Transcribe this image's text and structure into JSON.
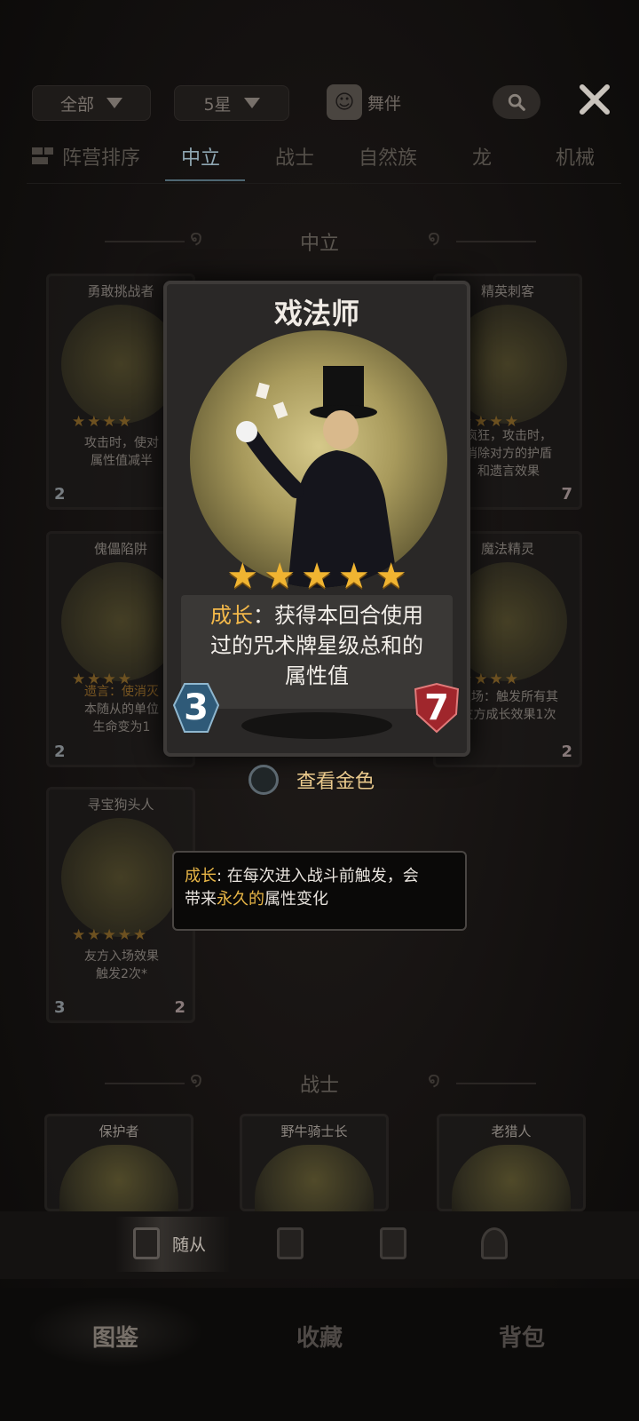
{
  "filters": {
    "all_label": "全部",
    "star_label": "5星",
    "companion_label": "舞伴"
  },
  "tabs": {
    "sort_label": "阵营排序",
    "items": [
      "中立",
      "战士",
      "自然族",
      "龙",
      "机械"
    ],
    "active": "中立"
  },
  "sections": {
    "neutral": "中立",
    "warrior": "战士"
  },
  "cards": [
    {
      "name": "勇敢挑战者",
      "stars": "★★★★",
      "desc_line1": "攻击时，使对",
      "desc_line2": "属性值减半",
      "cost": "2",
      "attack": ""
    },
    {
      "name": "精英刺客",
      "stars": "★★★★",
      "desc_line1": "疯狂，攻击时，",
      "desc_line2": "消除对方的护盾",
      "desc_line3": "和遗言效果",
      "cost": "",
      "attack": "7"
    },
    {
      "name": "傀儡陷阱",
      "stars": "★★★★",
      "desc_line1": "遗言：使消灭",
      "desc_line2": "本随从的单位",
      "desc_line3": "生命变为1",
      "cost": "2",
      "attack": "2"
    },
    {
      "name": "魔法精灵",
      "stars": "★★★★",
      "desc_line1": "入场：触发所有其",
      "desc_line2": "友方成长效果1次",
      "cost": "2",
      "attack": "2"
    },
    {
      "name": "寻宝狗头人",
      "stars": "★★★★★",
      "desc_line1": "友方入场效果",
      "desc_line2": "触发2次*",
      "cost": "3",
      "attack": "2"
    },
    {
      "name": "保护者"
    },
    {
      "name": "野牛骑士长"
    },
    {
      "name": "老猎人"
    }
  ],
  "featured_card": {
    "name": "戏法师",
    "stars": 5,
    "keyword": "成长",
    "desc_rest_line1": "：获得本回合使用",
    "desc_line2": "过的咒术牌星级总和的",
    "desc_line3": "属性值",
    "cost": "3",
    "attack": "7"
  },
  "view_gold_label": "查看金色",
  "tooltip": {
    "keyword": "成长",
    "text_part1": ": 在每次进入战斗前触发，会",
    "text_part2": "带来",
    "highlight": "永久的",
    "text_part3": "属性变化"
  },
  "subnav": {
    "minions_label": "随从"
  },
  "mainnav": {
    "items": [
      "图鉴",
      "收藏",
      "背包"
    ],
    "active": "图鉴"
  },
  "colors": {
    "accent_gold": "#f0b431",
    "keyword_orange": "#f3b84a",
    "tab_active": "#8fa7b3"
  }
}
